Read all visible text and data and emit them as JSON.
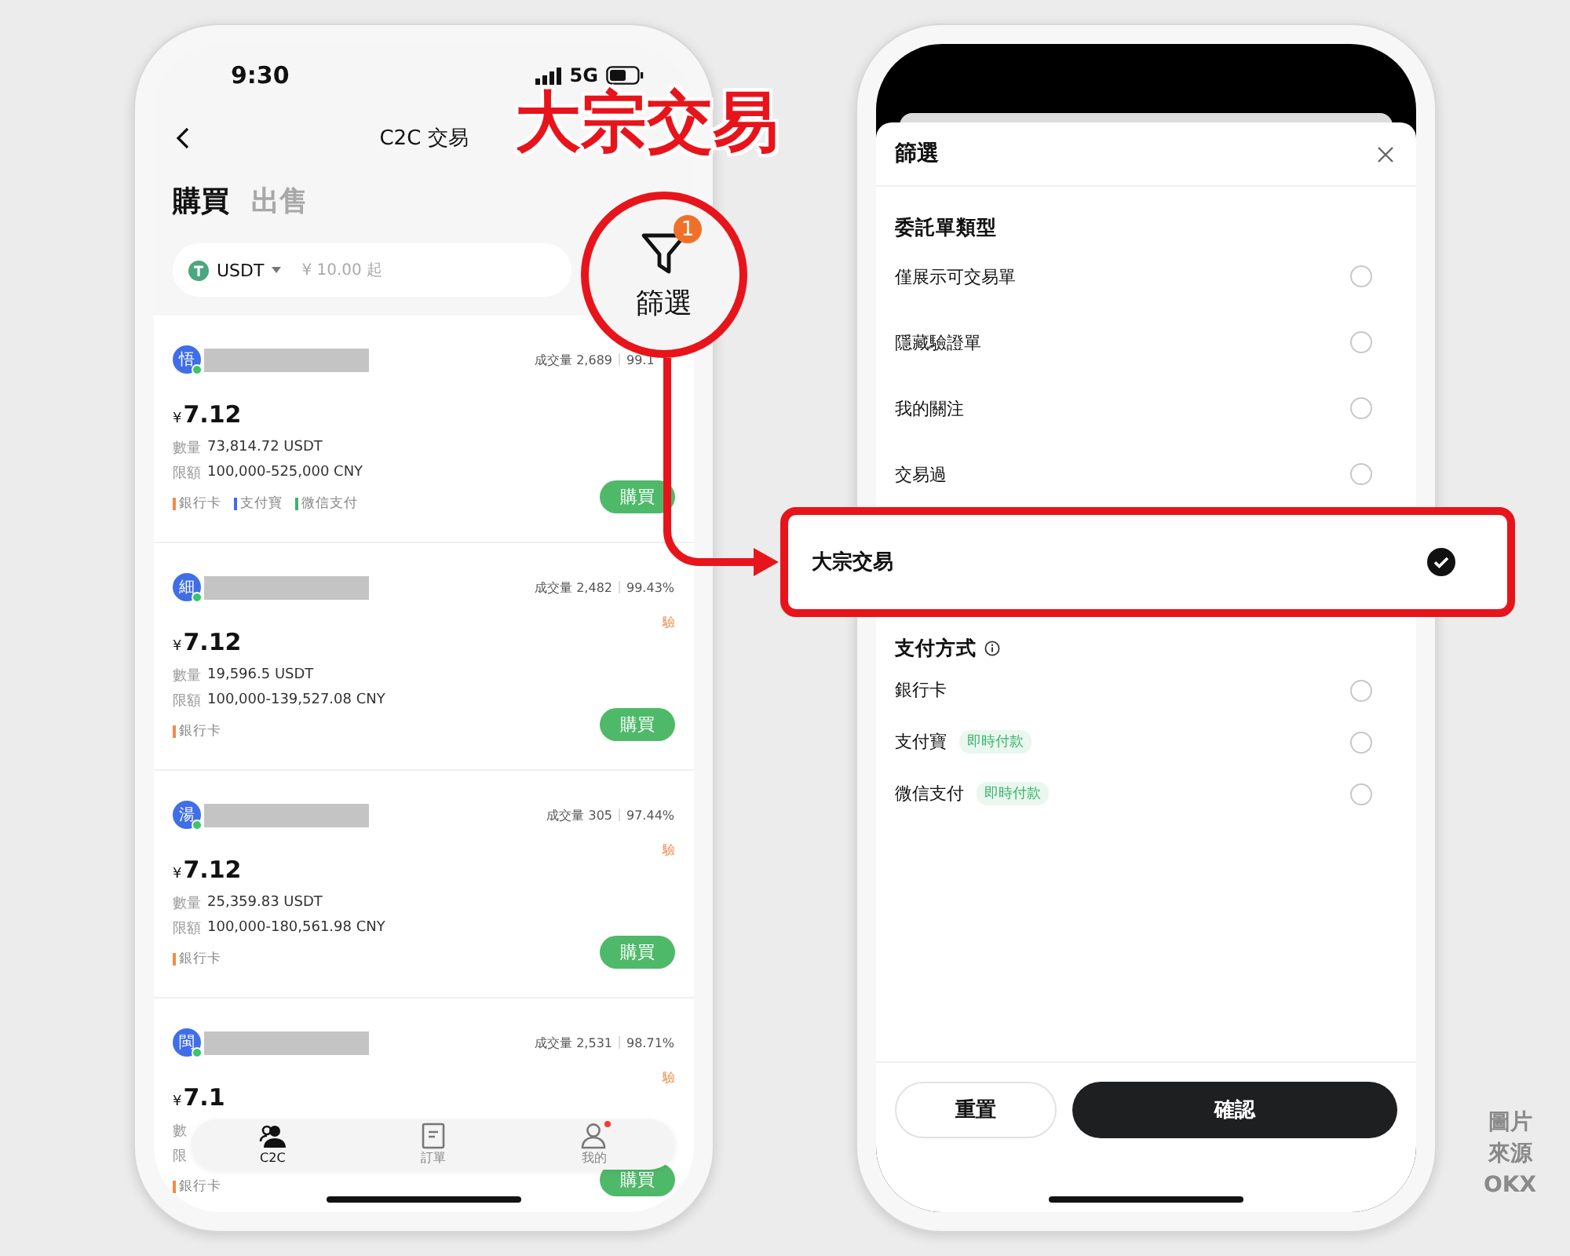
{
  "left_screen": {
    "status_bar": {
      "time": "9:30",
      "network": "5G"
    },
    "header": {
      "title": "C2C 交易"
    },
    "tabs": [
      {
        "label": "購買",
        "selected": true
      },
      {
        "label": "出售",
        "selected": false
      }
    ],
    "search": {
      "coin": "USDT",
      "placeholder": "¥ 10.00 起"
    },
    "listings": [
      {
        "avatar": "悟",
        "volume": "成交量 2,689",
        "rate": "99.1",
        "price_symbol": "¥",
        "price": "7.12",
        "quantity_label": "數量",
        "quantity": "73,814.72 USDT",
        "limit_label": "限額",
        "limit": "100,000-525,000 CNY",
        "payments": [
          {
            "label": "銀行卡",
            "color": "#f08c4a"
          },
          {
            "label": "支付寶",
            "color": "#3d6bf0"
          },
          {
            "label": "微信支付",
            "color": "#3cb46e"
          }
        ],
        "button": "購買"
      },
      {
        "avatar": "細",
        "volume": "成交量 2,482",
        "rate": "99.43%",
        "tag": "驗",
        "price_symbol": "¥",
        "price": "7.12",
        "quantity_label": "數量",
        "quantity": "19,596.5 USDT",
        "limit_label": "限額",
        "limit": "100,000-139,527.08 CNY",
        "payments": [
          {
            "label": "銀行卡",
            "color": "#f08c4a"
          }
        ],
        "button": "購買"
      },
      {
        "avatar": "湯",
        "volume": "成交量 305",
        "rate": "97.44%",
        "tag": "驗",
        "price_symbol": "¥",
        "price": "7.12",
        "quantity_label": "數量",
        "quantity": "25,359.83 USDT",
        "limit_label": "限額",
        "limit": "100,000-180,561.98 CNY",
        "payments": [
          {
            "label": "銀行卡",
            "color": "#f08c4a"
          }
        ],
        "button": "購買"
      },
      {
        "avatar": "閩",
        "volume": "成交量 2,531",
        "rate": "98.71%",
        "tag": "驗",
        "price_symbol": "¥",
        "price": "7.1",
        "quantity_label": "數",
        "limit_label": "限",
        "payments": [
          {
            "label": "銀行卡",
            "color": "#f08c4a"
          }
        ],
        "button": "購買"
      }
    ],
    "bottom_nav": [
      {
        "kind": "people",
        "label": "C2C",
        "selected": true,
        "badge": false
      },
      {
        "kind": "document",
        "label": "訂單",
        "selected": false,
        "badge": false
      },
      {
        "kind": "person",
        "label": "我的",
        "selected": false,
        "badge": true
      }
    ]
  },
  "right_screen": {
    "sheet": {
      "title": "篩選",
      "sections": [
        {
          "title": "委託單類型",
          "info": false,
          "options": [
            {
              "label": "僅展示可交易單",
              "selected": false,
              "highlighted": false
            },
            {
              "label": "隱藏驗證單",
              "selected": false,
              "highlighted": false
            },
            {
              "label": "我的關注",
              "selected": false,
              "highlighted": false
            },
            {
              "label": "交易過",
              "selected": false,
              "highlighted": false
            },
            {
              "label": "大宗交易",
              "selected": true,
              "highlighted": true
            }
          ]
        },
        {
          "title": "支付方式",
          "info": true,
          "options": [
            {
              "label": "銀行卡",
              "selected": false,
              "highlighted": false
            },
            {
              "label": "支付寶",
              "tag": "即時付款",
              "selected": false,
              "highlighted": false
            },
            {
              "label": "微信支付",
              "tag": "即時付款",
              "selected": false,
              "highlighted": false
            }
          ]
        }
      ],
      "buttons": [
        {
          "label": "重置",
          "kind": "secondary"
        },
        {
          "label": "確認",
          "kind": "primary"
        }
      ]
    }
  },
  "annotation": {
    "title": "大宗交易",
    "filter_badge": "1",
    "filter_label": "篩選"
  },
  "credit": [
    "圖片",
    "來源",
    "OKX"
  ]
}
